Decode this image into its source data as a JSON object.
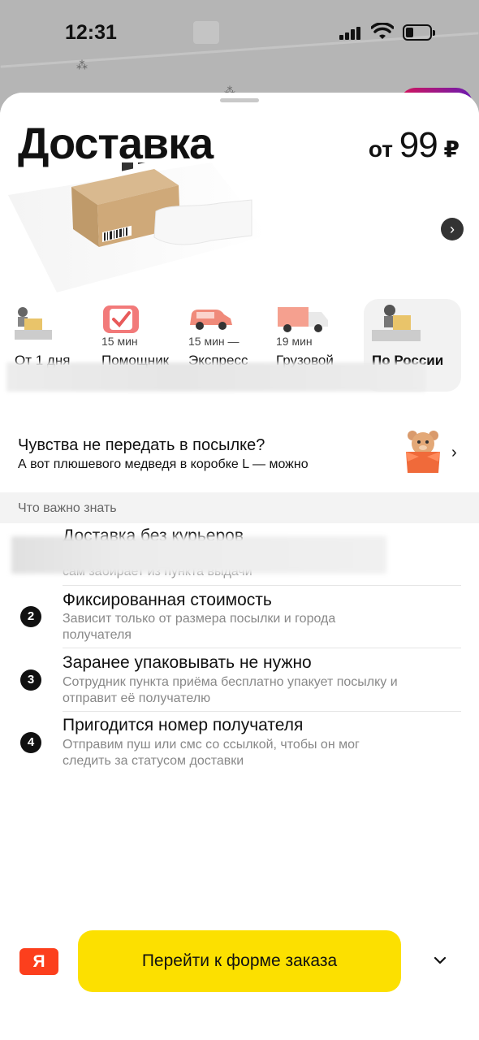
{
  "status_bar": {
    "time": "12:31"
  },
  "header": {
    "title": "Доставка",
    "price_prefix": "от",
    "price_value": "99",
    "price_currency": "₽"
  },
  "services": [
    {
      "time": "",
      "label": "От 1 дня",
      "selected": false
    },
    {
      "time": "15 мин",
      "label": "Помощник",
      "selected": false
    },
    {
      "time": "15 мин —",
      "label": "Экспресс",
      "selected": false
    },
    {
      "time": "19 мин",
      "label": "Грузовой",
      "selected": false
    },
    {
      "time": "",
      "label": "По России",
      "selected": true
    }
  ],
  "promo": {
    "title": "Чувства не передать в посылке?",
    "subtitle": "А вот плюшевого медведя в коробке L — можно"
  },
  "section": {
    "title": "Что важно знать"
  },
  "items": [
    {
      "num": "1",
      "title": "Доставка без курьеров",
      "desc": "сам забирает из пункта выдачи"
    },
    {
      "num": "2",
      "title": "Фиксированная стоимость",
      "desc": "Зависит только от размера посылки и города получателя"
    },
    {
      "num": "3",
      "title": "Заранее упаковывать не нужно",
      "desc": "Сотрудник пункта приёма бесплатно упакует посылку и отправит её получателю"
    },
    {
      "num": "4",
      "title": "Пригодится номер получателя",
      "desc": "Отправим пуш или смс со ссылкой, чтобы он мог следить за статусом доставки"
    }
  ],
  "footer": {
    "logo": "Я",
    "cta_label": "Перейти к форме заказа"
  },
  "colors": {
    "accent": "#fce000",
    "logo": "#fc3f1d"
  }
}
